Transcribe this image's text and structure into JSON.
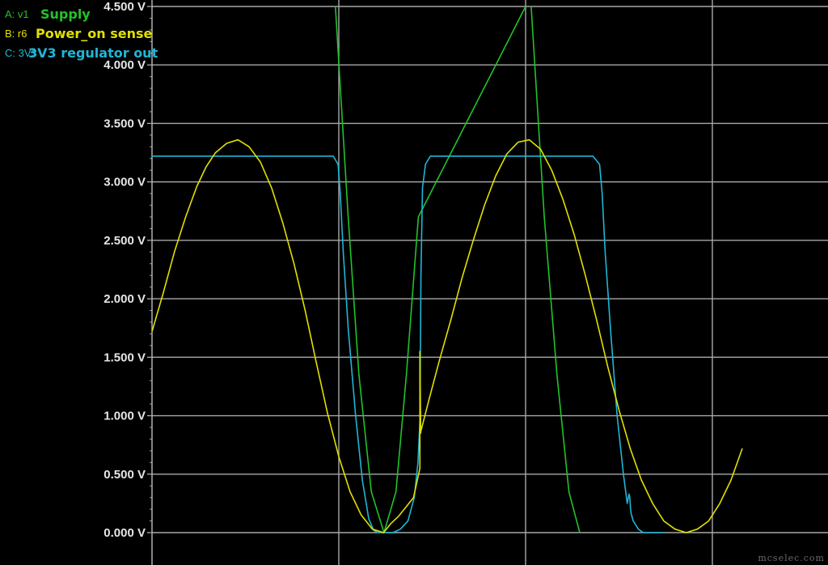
{
  "chart_data": {
    "type": "line",
    "y_ticks": [
      "0.000 V",
      "0.500 V",
      "1.000 V",
      "1.500 V",
      "2.000 V",
      "2.500 V",
      "3.000 V",
      "3.500 V",
      "4.000 V",
      "4.500 V"
    ],
    "ylim": [
      0,
      4.5
    ],
    "xlim": [
      0,
      100
    ],
    "grid": true,
    "legend_position": "top-left",
    "series": [
      {
        "key": "A: v1",
        "name": "Supply",
        "color": "#22c22a",
        "x": [
          0,
          49.1,
          52.5,
          55.4,
          58.7,
          62.1,
          65.3,
          68.1,
          71.3,
          100,
          100,
          101.5,
          105,
          108.4,
          111.6,
          114.5
        ],
        "y": [
          null,
          4.5,
          2.7,
          1.35,
          0.35,
          0.0,
          0.35,
          1.35,
          2.7,
          4.5,
          null,
          4.5,
          2.7,
          1.35,
          0.35,
          0.0
        ]
      },
      {
        "key": "B: r6",
        "name": "Power_on sense",
        "color": "#e0e000",
        "x": [
          0,
          3,
          6,
          9,
          12,
          14.5,
          17,
          20,
          23,
          26,
          29,
          32,
          35,
          38,
          41,
          44,
          47,
          50,
          53,
          56,
          59,
          62,
          64,
          66,
          68,
          70,
          71.7,
          71.7,
          71.9,
          71.9,
          72.0,
          74,
          77,
          80,
          83,
          86,
          89,
          92,
          95,
          98,
          101,
          104,
          107,
          110,
          113,
          116,
          119,
          122,
          125,
          128,
          131,
          134,
          137,
          140,
          143,
          146,
          149,
          152,
          155,
          158
        ],
        "y": [
          1.72,
          2.05,
          2.4,
          2.7,
          2.96,
          3.13,
          3.25,
          3.33,
          3.36,
          3.3,
          3.17,
          2.95,
          2.65,
          2.3,
          1.9,
          1.45,
          1.02,
          0.65,
          0.35,
          0.15,
          0.03,
          0.0,
          0.08,
          0.14,
          0.22,
          0.3,
          0.55,
          1.55,
          0.9,
          0.85,
          0.87,
          1.12,
          1.48,
          1.82,
          2.18,
          2.5,
          2.8,
          3.05,
          3.24,
          3.34,
          3.36,
          3.28,
          3.1,
          2.85,
          2.55,
          2.2,
          1.82,
          1.42,
          1.05,
          0.72,
          0.45,
          0.25,
          0.1,
          0.03,
          0.0,
          0.03,
          0.1,
          0.25,
          0.45,
          0.72
        ]
      },
      {
        "key": "C: 3V3",
        "name": "3V3 regulator out",
        "color": "#1fb6d6",
        "x": [
          0,
          10,
          20,
          30,
          40,
          48.5,
          49.8,
          50.4,
          51.2,
          52.5,
          54.5,
          56.3,
          58,
          59.3,
          60.5,
          62,
          64.5,
          66.5,
          68.5,
          70.2,
          71.2,
          71.7,
          72.0,
          72.4,
          73.2,
          74.5,
          76,
          80,
          90,
          100,
          110,
          118,
          119.8,
          120.5,
          121.3,
          122.7,
          124.5,
          126.2,
          127.2,
          127.7,
          127.9,
          128.1,
          128.3,
          128.8,
          130.2,
          131.5,
          133.5,
          137
        ],
        "y": [
          3.22,
          3.22,
          3.22,
          3.22,
          3.22,
          3.22,
          3.15,
          2.9,
          2.4,
          1.75,
          1.0,
          0.45,
          0.12,
          0.02,
          0.0,
          0.0,
          0.0,
          0.03,
          0.1,
          0.3,
          0.6,
          0.95,
          2.2,
          2.95,
          3.15,
          3.22,
          3.22,
          3.22,
          3.22,
          3.22,
          3.22,
          3.22,
          3.15,
          2.9,
          2.4,
          1.75,
          1.0,
          0.5,
          0.25,
          0.33,
          0.3,
          0.2,
          0.16,
          0.1,
          0.03,
          0.0,
          0.0,
          0.0
        ]
      }
    ]
  },
  "watermark": "mcselec.com"
}
